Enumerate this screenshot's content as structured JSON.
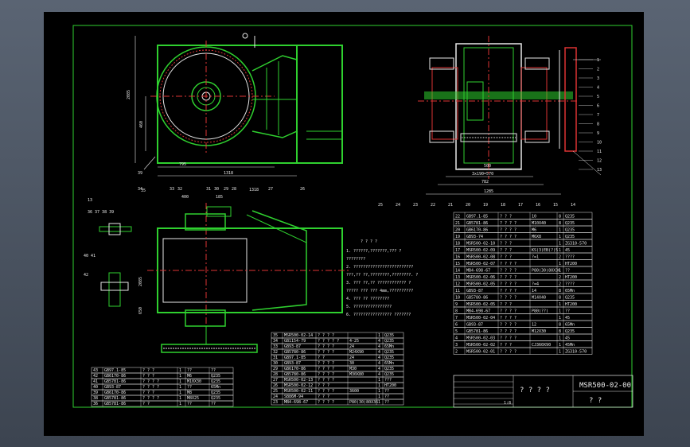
{
  "title_block": {
    "drawing_no": "MSR500-02-00",
    "title": "? ? ? ?",
    "subtitle": "? ?",
    "scale": "1:8",
    "sheet_label": "? ?"
  },
  "balloons_front": [
    "39"
  ],
  "front_dims": {
    "h1": "2085",
    "h2": "460",
    "w1": "795",
    "w2": "1318"
  },
  "section_dims": {
    "d1": "500",
    "d2": "3x190=570",
    "d3": "782",
    "d4": "1285"
  },
  "section_balloons_right": [
    "1",
    "2",
    "3",
    "4",
    "5",
    "6",
    "7",
    "8",
    "9",
    "10",
    "11",
    "12",
    "13"
  ],
  "section_balloons_bottom": [
    "25",
    "24",
    "23",
    "22",
    "21",
    "20",
    "19",
    "18",
    "17",
    "16",
    "15",
    "14"
  ],
  "plan_balloons": [
    "34",
    "33",
    "32",
    "31",
    "30",
    "29",
    "28",
    "27",
    "26"
  ],
  "plan_dims": {
    "a": "400",
    "b": "185",
    "c": "1318",
    "side": "2085",
    "low": "650"
  },
  "detail_labels": {
    "d1": "35",
    "d2": "36 37 38 39",
    "d3": "40 41",
    "d4": "42",
    "d5": "13"
  },
  "notes": {
    "heading": "? ? ? ?",
    "lines": [
      "1. ??????,???????,???      ?",
      "   ????????",
      "2. ?????????????????????????",
      "   ???,??  ??,????????,????????.  ?",
      "3. ???  ??,??  ????????????   ?",
      "   ?????  ???  ??? 4mm,??????????",
      "4. ??? ??  ????????",
      "5. ????????????????",
      "6. ????????????????       ???????"
    ]
  },
  "bom_left": [
    {
      "no": "43",
      "code": "GB97.1-85",
      "name": "? ?  ?",
      "qty": "1",
      "mat": "??",
      "note": "??"
    },
    {
      "no": "42",
      "code": "GB6170-86",
      "name": "? ?  ?",
      "qty": "1",
      "mat": "M6",
      "note": "Q235"
    },
    {
      "no": "41",
      "code": "GB5781-86",
      "name": "? ? ? ?",
      "qty": "1",
      "mat": "M10X30",
      "note": "Q235"
    },
    {
      "no": "40",
      "code": "GB93-87",
      "name": "? ? ? ?",
      "qty": "1",
      "mat": "??",
      "note": "65Mn"
    },
    {
      "no": "39",
      "code": "GB6170-86",
      "name": "? ?  ?",
      "qty": "1",
      "mat": "M8",
      "note": "Q235"
    },
    {
      "no": "38",
      "code": "GB5781-86",
      "name": "? ? ? ?",
      "qty": "1",
      "mat": "M8X25",
      "note": "Q235"
    },
    {
      "no": "36",
      "code": "GB5781-86",
      "name": "? ?",
      "qty": "1",
      "mat": "??",
      "note": "??"
    }
  ],
  "bom_mid": [
    {
      "no": "35",
      "code": "MSR500-02-14",
      "name": "? ? ? ?",
      "qty": "1",
      "note": "Q235"
    },
    {
      "no": "34",
      "code": "GB1154-79",
      "name": "? ? ? ? ?",
      "mat": "4-25",
      "qty": "4",
      "note": "Q235"
    },
    {
      "no": "33",
      "code": "GB93-87",
      "name": "? ? ? ?",
      "mat": "24",
      "qty": "4",
      "note": "65Mn"
    },
    {
      "no": "32",
      "code": "GB5780-86",
      "name": "? ? ? ?",
      "mat": "M24X90",
      "qty": "4",
      "note": "Q235"
    },
    {
      "no": "31",
      "code": "GB97.1-85",
      "name": "? ?",
      "mat": "24",
      "qty": "4",
      "note": "Q235"
    },
    {
      "no": "30",
      "code": "GB93-87",
      "name": "? ? ? ?",
      "mat": "30",
      "qty": "4",
      "note": "65Mn"
    },
    {
      "no": "29",
      "code": "GB6170-86",
      "name": "? ? ? ?",
      "mat": "M30",
      "qty": "4",
      "note": "Q235"
    },
    {
      "no": "28",
      "code": "GB5780-86",
      "name": "? ? ? ?",
      "mat": "M30X80",
      "qty": "4",
      "note": "Q235"
    },
    {
      "no": "27",
      "code": "MSR500-02-13",
      "name": "? ? ? ?",
      "qty": "1",
      "note": "???"
    },
    {
      "no": "26",
      "code": "MSR500-02-12",
      "name": "? ? ?",
      "qty": "1",
      "note": "HT200"
    },
    {
      "no": "25",
      "code": "MSR500-02-11",
      "name": "? ? ? ?",
      "mat": "3600",
      "qty": "1",
      "note": "??"
    },
    {
      "no": "24",
      "code": "SB86M-94",
      "name": "? ? ?",
      "mat": "",
      "qty": "1",
      "note": "??"
    },
    {
      "no": "23",
      "code": "MB4-698-67",
      "name": "? ? ? ?",
      "mat": "P80(30)80X36",
      "qty": "1",
      "note": "??"
    }
  ],
  "bom_right": [
    {
      "no": "22",
      "code": "GB97.1-85",
      "name": "? ?  ?",
      "mat": "10",
      "qty": "8",
      "note": "Q235"
    },
    {
      "no": "21",
      "code": "GB5781-86",
      "name": "? ? ? ?",
      "mat": "M10X40",
      "qty": "8",
      "note": "Q235"
    },
    {
      "no": "20",
      "code": "GB6170-86",
      "name": "? ? ? ?",
      "mat": "M6",
      "qty": "1",
      "note": "Q235"
    },
    {
      "no": "19",
      "code": "GB93-74",
      "name": "? ? ? ?",
      "mat": "M6X8",
      "qty": "1",
      "note": "Q235"
    },
    {
      "no": "18",
      "code": "MSR500-02-10",
      "name": "? ? ?",
      "mat": "",
      "qty": "1",
      "note": "ZG310-570"
    },
    {
      "no": "17",
      "code": "MSR500-02-09",
      "name": "? ? ?",
      "mat": "KS(3)EB(?)5",
      "qty": "1",
      "note": "45"
    },
    {
      "no": "16",
      "code": "MSR500-02-08",
      "name": "? ? ?",
      "mat": "?=1",
      "qty": "2",
      "note": "????"
    },
    {
      "no": "15",
      "code": "MSR500-02-07",
      "name": "? ? ? ?",
      "mat": "",
      "qty": "1",
      "note": "HT200"
    },
    {
      "no": "14",
      "code": "MB4-698-67",
      "name": "? ? ? ?",
      "mat": "P80(30)80X36",
      "qty": "1",
      "note": "??"
    },
    {
      "no": "13",
      "code": "MSR500-02-06",
      "name": "? ? ? ?",
      "mat": "",
      "qty": "2",
      "note": "HT200"
    },
    {
      "no": "12",
      "code": "MSR500-02-05",
      "name": "? ? ? ?",
      "mat": "?=4",
      "qty": "2",
      "note": "????"
    },
    {
      "no": "11",
      "code": "GB93-87",
      "name": "? ? ? ?",
      "mat": "14",
      "qty": "8",
      "note": "65Mn"
    },
    {
      "no": "10",
      "code": "GB5780-86",
      "name": "? ? ? ?",
      "mat": "M14X40",
      "qty": "8",
      "note": "Q235"
    },
    {
      "no": "9",
      "code": "MSR500-02-05",
      "name": "? ? ?",
      "mat": "",
      "qty": "1",
      "note": "HT200"
    },
    {
      "no": "8",
      "code": "MB4-698-67",
      "name": "? ? ? ?",
      "mat": "P80(??)",
      "qty": "1",
      "note": "??"
    },
    {
      "no": "7",
      "code": "MSR500-02-04",
      "name": "? ? ? ?",
      "mat": "",
      "qty": "1",
      "note": "45"
    },
    {
      "no": "6",
      "code": "GB93-87",
      "name": "? ? ? ?",
      "mat": "12",
      "qty": "8",
      "note": "65Mn"
    },
    {
      "no": "5",
      "code": "GB5781-86",
      "name": "? ? ? ?",
      "mat": "M12X30",
      "qty": "8",
      "note": "Q235"
    },
    {
      "no": "4",
      "code": "MSR500-02-03",
      "name": "? ? ? ?",
      "mat": "",
      "qty": "1",
      "note": "45"
    },
    {
      "no": "3",
      "code": "MSR500-02-02",
      "name": "? ? ?",
      "mat": "CJ360X90",
      "qty": "1",
      "note": "45Mn"
    },
    {
      "no": "2",
      "code": "MSR500-02-01",
      "name": "? ? ? ?",
      "mat": "",
      "qty": "1",
      "note": "ZG310-570"
    }
  ]
}
